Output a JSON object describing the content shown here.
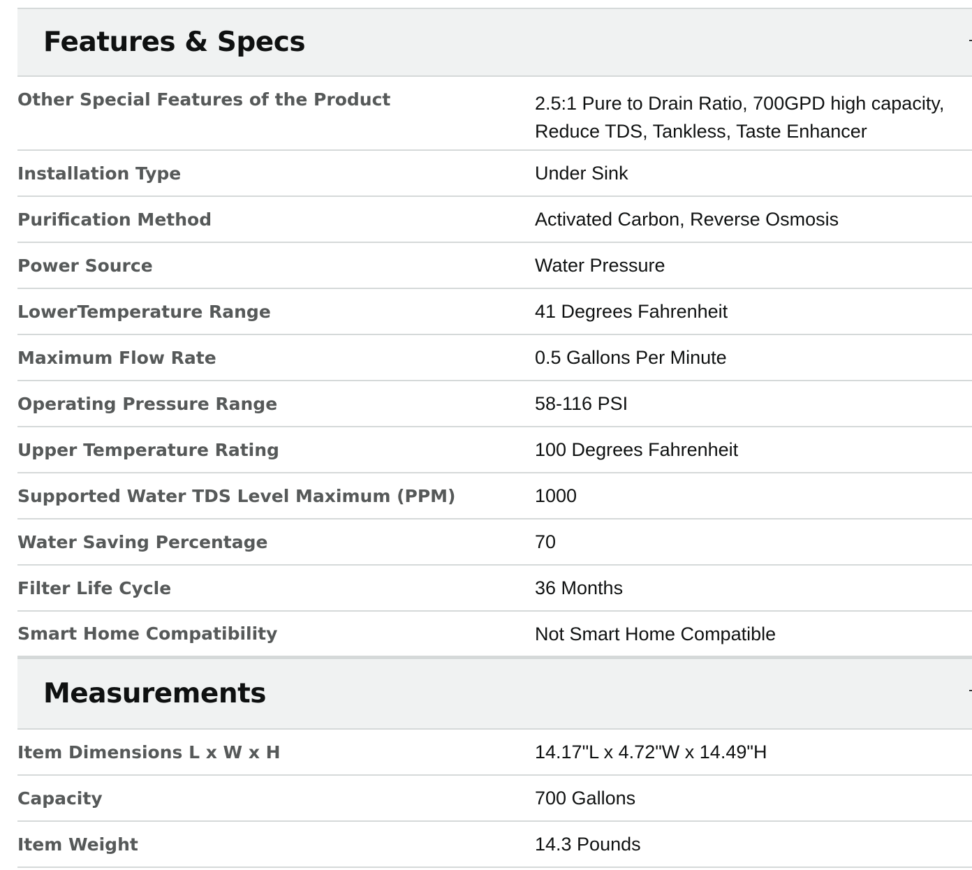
{
  "sections": [
    {
      "title": "Features & Specs",
      "rows": [
        {
          "label": "Other Special Features of the Product",
          "value_line1": "2.5:1 Pure to Drain Ratio, 700GPD high capacity,",
          "value_line2": "Reduce TDS, Tankless, Taste Enhancer"
        },
        {
          "label": "Installation Type",
          "value": "Under Sink"
        },
        {
          "label": "Purification Method",
          "value": "Activated Carbon, Reverse Osmosis"
        },
        {
          "label": "Power Source",
          "value": "Water Pressure"
        },
        {
          "label": "LowerTemperature Range",
          "value": "41 Degrees Fahrenheit"
        },
        {
          "label": "Maximum Flow Rate",
          "value": "0.5 Gallons Per Minute"
        },
        {
          "label": "Operating Pressure Range",
          "value": "58-116 PSI"
        },
        {
          "label": "Upper Temperature Rating",
          "value": "100 Degrees Fahrenheit"
        },
        {
          "label": "Supported Water TDS Level Maximum (PPM)",
          "value": "1000"
        },
        {
          "label": "Water Saving Percentage",
          "value": "70"
        },
        {
          "label": "Filter Life Cycle",
          "value": "36 Months"
        },
        {
          "label": "Smart Home Compatibility",
          "value": "Not Smart Home Compatible"
        }
      ]
    },
    {
      "title": "Measurements",
      "rows": [
        {
          "label": "Item Dimensions L x W x H",
          "value": "14.17\"L x 4.72\"W x 14.49\"H"
        },
        {
          "label": "Capacity",
          "value": "700 Gallons"
        },
        {
          "label": "Item Weight",
          "value": "14.3 Pounds"
        }
      ]
    }
  ],
  "icons": {
    "collapse": "chevron-up-icon"
  }
}
